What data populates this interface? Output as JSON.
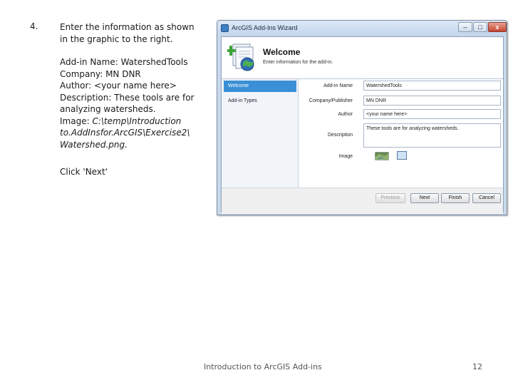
{
  "slide": {
    "step_number": "4.",
    "intro": "Enter the information as shown in the graphic to the right.",
    "addin_name_line": "Add-in Name: WatershedTools",
    "company_line": "Company: MN DNR",
    "author_line": "Author: <your name here>",
    "description_line": "Description: These tools are for analyzing watersheds.",
    "image_label": "Image: ",
    "image_path_1": "C:\\temp\\Introduction",
    "image_path_2": "to.AddInsfor.ArcGIS\\Exercise2\\",
    "image_path_3": "Watershed.png.",
    "click_next": "Click 'Next'",
    "footer_text": "Introduction to ArcGIS Add-ins",
    "page_number": "12"
  },
  "wizard": {
    "window_title": "ArcGIS Add-Ins Wizard",
    "minimize": "–",
    "maximize": "□",
    "close": "x",
    "header_title": "Welcome",
    "header_subtitle": "Enter information for the add-in.",
    "nav": [
      {
        "label": "Welcome",
        "selected": true
      },
      {
        "label": "Add-in Types",
        "selected": false
      }
    ],
    "fields": {
      "addin_name_label": "Add-in Name",
      "addin_name_value": "WatershedTools",
      "company_label": "Company/Publisher",
      "company_value": "MN DNR",
      "author_label": "Author",
      "author_value": "<your name here>",
      "description_label": "Description",
      "description_value": "These tools are for analyzing watersheds.",
      "image_label": "Image"
    },
    "buttons": {
      "previous": "Previous",
      "next": "Next",
      "finish": "Finish",
      "cancel": "Cancel"
    },
    "colors": {
      "selected_nav": "#3a8fd6",
      "frame": "#c9d9ec"
    }
  }
}
